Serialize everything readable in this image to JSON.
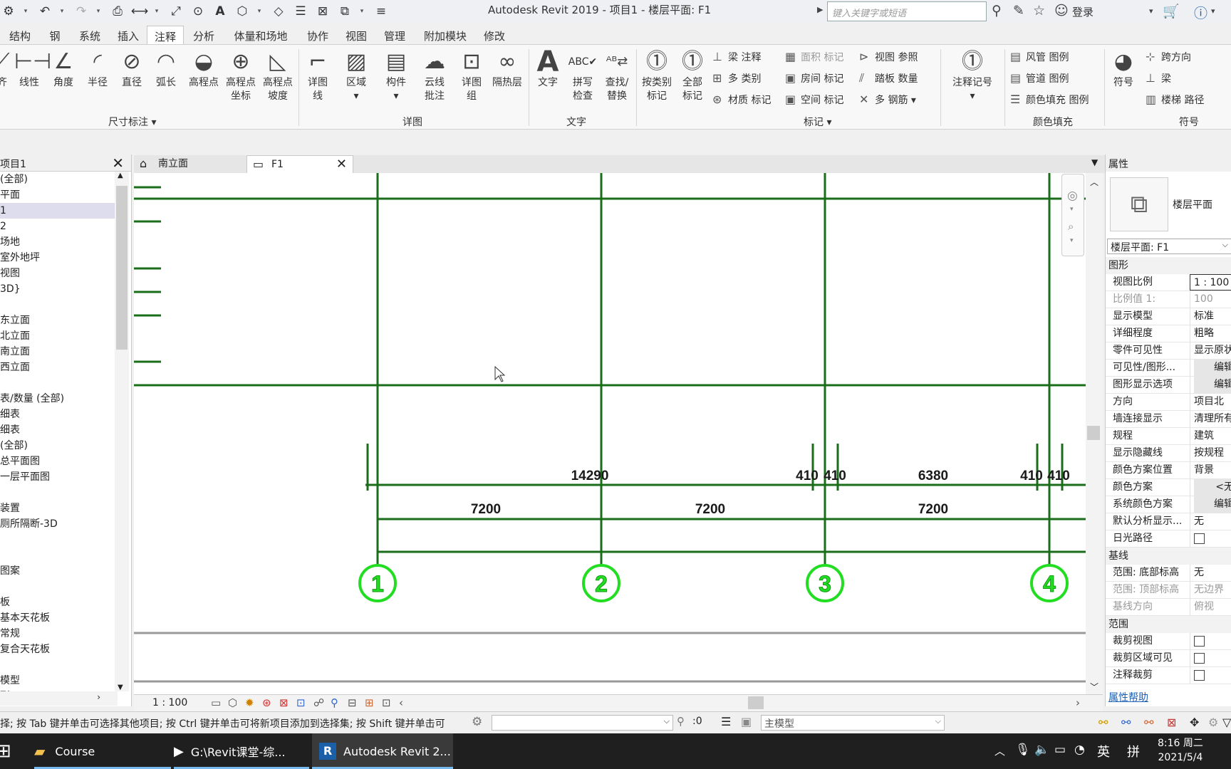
{
  "title_bar": {
    "app_title": "Autodesk Revit 2019 - 项目1 - 楼层平面: F1",
    "search_placeholder": "键入关键字或短语",
    "login_label": "登录"
  },
  "ribbon_tabs": [
    "结构",
    "钢",
    "系统",
    "插入",
    "注释",
    "分析",
    "体量和场地",
    "协作",
    "视图",
    "管理",
    "附加模块",
    "修改"
  ],
  "ribbon": {
    "dimension": {
      "panel_title": "尺寸标注",
      "buttons": [
        "齐",
        "线性",
        "角度",
        "半径",
        "直径",
        "弧长",
        "高程点",
        "高程点\n坐标",
        "高程点\n坡度"
      ]
    },
    "detail": {
      "panel_title": "详图",
      "buttons": [
        "详图\n线",
        "区域",
        "构件",
        "云线\n批注",
        "详图\n组",
        "隔热层"
      ]
    },
    "text": {
      "panel_title": "文字",
      "buttons": [
        "文字",
        "拼写\n检查",
        "查找/\n替换"
      ]
    },
    "tag": {
      "panel_title": "标记",
      "buttons": [
        "按类别\n标记",
        "全部\n标记"
      ],
      "small": [
        "梁 注释",
        "多 类别",
        "材质 标记",
        "面积 标记",
        "房间 标记",
        "空间 标记",
        "视图 参照",
        "踏板  数量",
        "多  钢筋"
      ],
      "keynote": "注释记号"
    },
    "color_fill": {
      "panel_title": "颜色填充",
      "small": [
        "风管 图例",
        "管道 图例",
        "颜色填充 图例"
      ]
    },
    "symbol": {
      "panel_title": "符号",
      "button": "符号",
      "small": [
        "跨方向",
        "梁",
        "楼梯  路径"
      ]
    }
  },
  "project_browser": {
    "title": "项目1",
    "rows": [
      "(全部)",
      "平面",
      "1",
      "2",
      "场地",
      "室外地坪",
      "视图",
      "3D}",
      "",
      "东立面",
      "北立面",
      "南立面",
      "西立面",
      "",
      "表/数量 (全部)",
      "细表",
      "细表",
      "(全部)",
      "  总平面图",
      "  一层平面图",
      "",
      "装置",
      "厕所隔断-3D",
      "",
      "",
      "图案",
      "",
      "板",
      "基本天花板",
      "  常规",
      "复合天花板",
      "",
      "模型",
      "形"
    ],
    "selected_index": 2
  },
  "view_tabs": [
    {
      "label": "南立面",
      "active": false
    },
    {
      "label": "F1",
      "active": true
    }
  ],
  "drawing": {
    "grid_bubbles": [
      "1",
      "2",
      "3",
      "4"
    ],
    "dimensions_top": [
      "14290",
      "410",
      "410",
      "6380",
      "410",
      "410"
    ],
    "dimensions_bottom": [
      "7200",
      "7200",
      "7200"
    ]
  },
  "view_control": {
    "scale": "1 : 100"
  },
  "properties": {
    "title": "属性",
    "type_name": "楼层平面",
    "type_selector": "楼层平面: F1",
    "groups": [
      {
        "name": "图形",
        "rows": [
          {
            "name": "视图比例",
            "value": "1 : 100",
            "kind": "input"
          },
          {
            "name": "比例值 1:",
            "value": "100",
            "kind": "dim"
          },
          {
            "name": "显示模型",
            "value": "标准",
            "kind": "text"
          },
          {
            "name": "详细程度",
            "value": "粗略",
            "kind": "text"
          },
          {
            "name": "零件可见性",
            "value": "显示原状",
            "kind": "text"
          },
          {
            "name": "可见性/图形...",
            "value": "编辑",
            "kind": "button"
          },
          {
            "name": "图形显示选项",
            "value": "编辑",
            "kind": "button"
          },
          {
            "name": "方向",
            "value": "项目北",
            "kind": "text"
          },
          {
            "name": "墙连接显示",
            "value": "清理所有",
            "kind": "text"
          },
          {
            "name": "规程",
            "value": "建筑",
            "kind": "text"
          },
          {
            "name": "显示隐藏线",
            "value": "按规程",
            "kind": "text"
          },
          {
            "name": "颜色方案位置",
            "value": "背景",
            "kind": "text"
          },
          {
            "name": "颜色方案",
            "value": "<无",
            "kind": "button"
          },
          {
            "name": "系统颜色方案",
            "value": "编辑",
            "kind": "button"
          },
          {
            "name": "默认分析显示...",
            "value": "无",
            "kind": "text"
          },
          {
            "name": "日光路径",
            "value": "",
            "kind": "check"
          }
        ]
      },
      {
        "name": "基线",
        "rows": [
          {
            "name": "范围: 底部标高",
            "value": "无",
            "kind": "text"
          },
          {
            "name": "范围: 顶部标高",
            "value": "无边界",
            "kind": "dim"
          },
          {
            "name": "基线方向",
            "value": "俯视",
            "kind": "dim"
          }
        ]
      },
      {
        "name": "范围",
        "rows": [
          {
            "name": "裁剪视图",
            "value": "",
            "kind": "check"
          },
          {
            "name": "裁剪区域可见",
            "value": "",
            "kind": "check"
          },
          {
            "name": "注释裁剪",
            "value": "",
            "kind": "check"
          }
        ]
      }
    ],
    "help_link": "属性帮助"
  },
  "status_bar": {
    "text": "择; 按 Tab 键并单击可选择其他项目; 按 Ctrl 键并单击可将新项目添加到选择集; 按 Shift 键并单击可",
    "selection_count": ":0",
    "model_dropdown": "主模型"
  },
  "taskbar": {
    "items": [
      {
        "label": "Course",
        "active": false
      },
      {
        "label": "G:\\Revit课堂-综...",
        "active": false
      },
      {
        "label": "Autodesk Revit 2...",
        "active": true
      }
    ],
    "ime": "英",
    "ime2": "拼",
    "time": "8:16 周二",
    "date": "2021/5/4"
  },
  "colors": {
    "grid_line": "#1a6e1a",
    "bubble": "#22dd22",
    "link": "#1a5fb4"
  }
}
